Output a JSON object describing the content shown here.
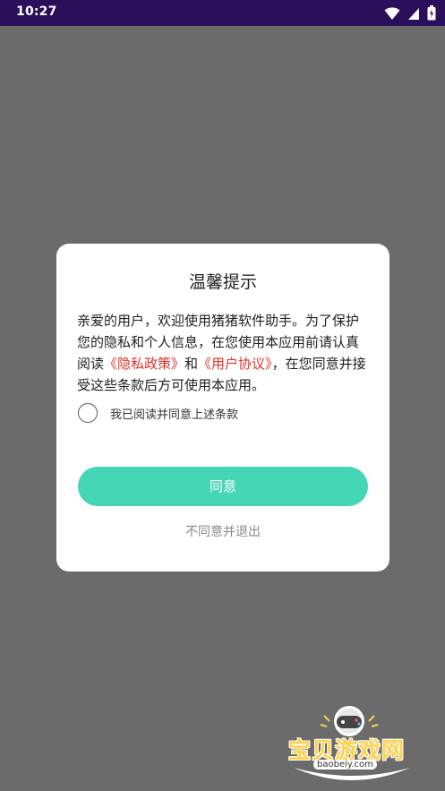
{
  "status_bar": {
    "time": "10:27",
    "icons": [
      "wifi-icon",
      "signal-icon",
      "battery-icon"
    ],
    "background": "#2b0f5a"
  },
  "dialog": {
    "title": "温馨提示",
    "body_prefix": "亲爱的用户，欢迎使用猪猪软件助手。为了保护您的隐私和个人信息，在您使用本应用前请认真阅读",
    "privacy_link": "《隐私政策》",
    "connector": "和",
    "agreement_link": "《用户协议》",
    "body_suffix": "，在您同意并接受这些条款后方可使用本应用。",
    "checkbox_label": "我已阅读并同意上述条款",
    "agree_label": "同意",
    "disagree_label": "不同意并退出",
    "accent_color": "#45d6b6",
    "link_color": "#e0322d"
  },
  "watermark": {
    "title": "宝贝游戏网",
    "url": "baobeiy.com"
  }
}
